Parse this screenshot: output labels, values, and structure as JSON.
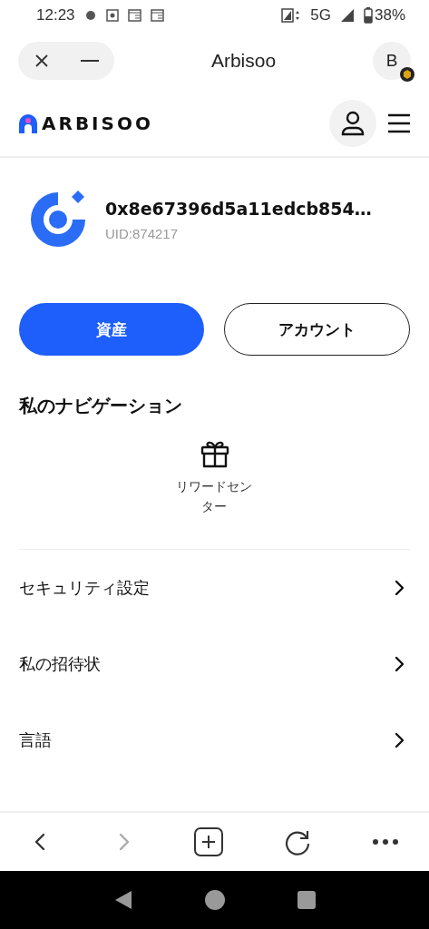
{
  "status_bar": {
    "time": "12:23",
    "network": "5G",
    "battery": "38%"
  },
  "browser_header": {
    "title": "Arbisoo",
    "avatar": "B"
  },
  "site_header": {
    "logo": "ARBISOO"
  },
  "profile": {
    "address": "0x8e67396d5a11edcb854…",
    "uid": "UID:874217"
  },
  "buttons": [
    {
      "label": "資産",
      "kind": "primary"
    },
    {
      "label": "アカウント",
      "kind": "outline"
    }
  ],
  "navigation": {
    "title": "私のナビゲーション",
    "items": [
      {
        "label": "リワードセンター"
      }
    ]
  },
  "menu": [
    {
      "label": "セキュリティ設定"
    },
    {
      "label": "私の招待状"
    },
    {
      "label": "言語"
    }
  ],
  "browser_toolbar": {
    "back_disabled": false,
    "forward_disabled": true
  }
}
